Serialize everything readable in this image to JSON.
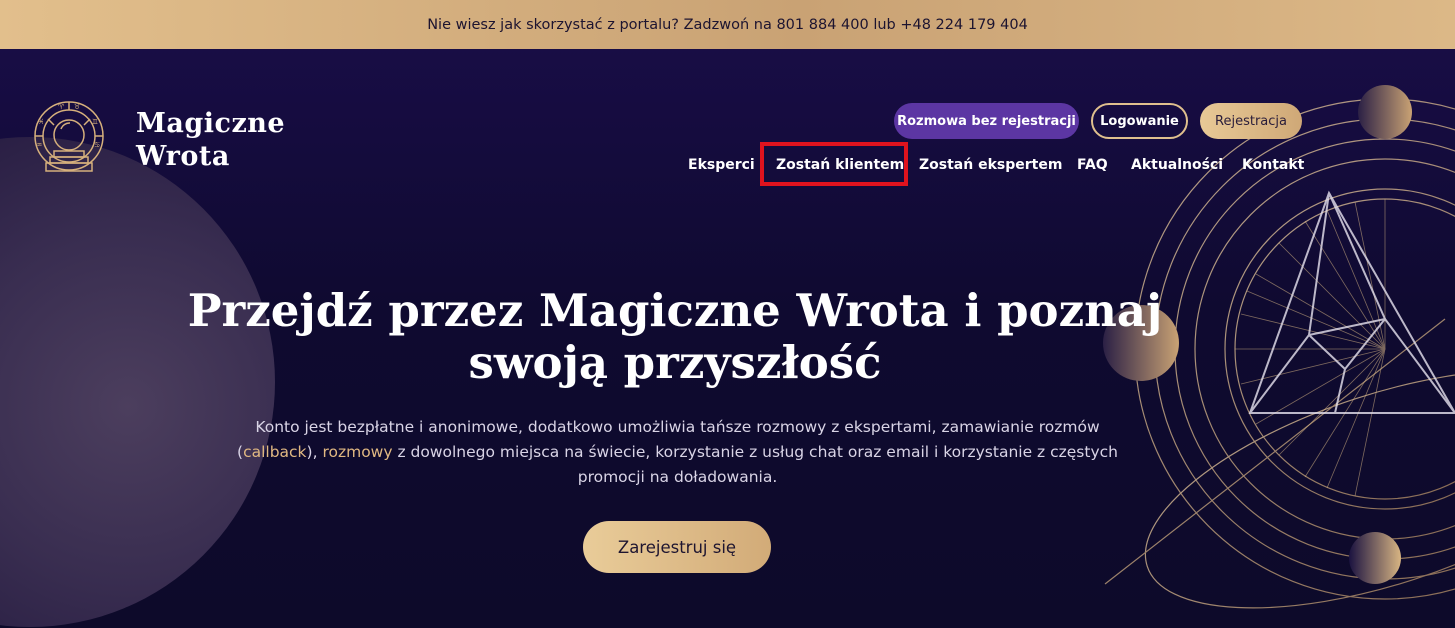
{
  "topbar": {
    "text": "Nie wiesz jak skorzystać z portalu? Zadzwoń na 801 884 400 lub +48 224 179 404"
  },
  "brand": {
    "line1": "Magiczne",
    "line2": "Wrota",
    "logo_icon": "zodiac-crystal-ball-icon"
  },
  "header_buttons": {
    "talk": "Rozmowa bez rejestracji",
    "login": "Logowanie",
    "register": "Rejestracja"
  },
  "nav": [
    "Eksperci",
    "Zostań klientem",
    "Zostań ekspertem",
    "FAQ",
    "Aktualności",
    "Kontakt"
  ],
  "hero": {
    "title_line1": "Przejdź przez Magiczne Wrota i poznaj",
    "title_line2": "swoją przyszłość",
    "desc_part1": "Konto jest bezpłatne i anonimowe, dodatkowo umożliwia tańsze rozmowy z ekspertami, zamawianie rozmów (",
    "desc_link1": "callback",
    "desc_part2": "), ",
    "desc_link2": "rozmowy",
    "desc_part3": " z dowolnego miejsca na świecie, korzystanie z usług chat oraz email i korzystanie z częstych promocji na doładowania.",
    "cta": "Zarejestruj się"
  },
  "colors": {
    "gold": "#d6b07c",
    "purple_button": "#5c36a3",
    "background": "#0f0a30",
    "highlight": "#e0131e"
  }
}
